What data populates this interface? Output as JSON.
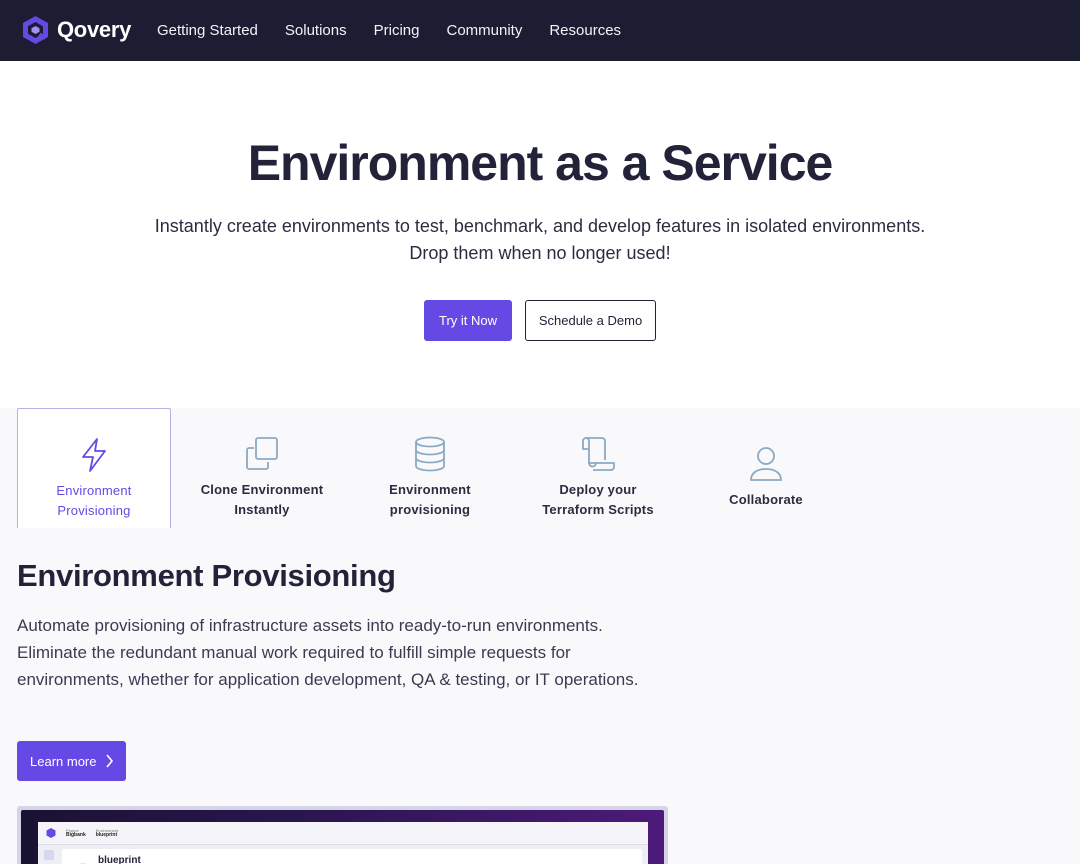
{
  "nav": {
    "brand": "Qovery",
    "items": [
      "Getting Started",
      "Solutions",
      "Pricing",
      "Community",
      "Resources"
    ]
  },
  "hero": {
    "title": "Environment as a Service",
    "subtitle_line1": "Instantly create environments to test, benchmark, and develop features in isolated environments.",
    "subtitle_line2": "Drop them when no longer used!",
    "primary_cta": "Try it Now",
    "secondary_cta": "Schedule a Demo"
  },
  "tabs": [
    {
      "line1": "Environment",
      "line2": "Provisioning",
      "icon": "lightning-icon",
      "active": true
    },
    {
      "line1": "Clone Environment",
      "line2": "Instantly",
      "icon": "copy-icon",
      "active": false
    },
    {
      "line1": "Environment",
      "line2": "provisioning",
      "icon": "database-icon",
      "active": false
    },
    {
      "line1": "Deploy your",
      "line2": "Terraform Scripts",
      "icon": "scroll-icon",
      "active": false
    },
    {
      "line1": "Collaborate",
      "line2": "",
      "icon": "user-icon",
      "active": false
    }
  ],
  "feature": {
    "title": "Environment Provisioning",
    "body": "Automate provisioning of infrastructure assets into ready-to-run environments. Eliminate the redundant manual work required to fulfill simple requests for environments, whether for application development, QA & testing, or IT operations.",
    "cta": "Learn more"
  },
  "preview": {
    "project_label": "Project",
    "project_value": "Bigbank",
    "environment_label": "Environment",
    "environment_value": "blueprint",
    "app_title": "blueprint"
  },
  "colors": {
    "nav_bg": "#1c1c32",
    "accent": "#6549e5",
    "heading": "#222339"
  }
}
